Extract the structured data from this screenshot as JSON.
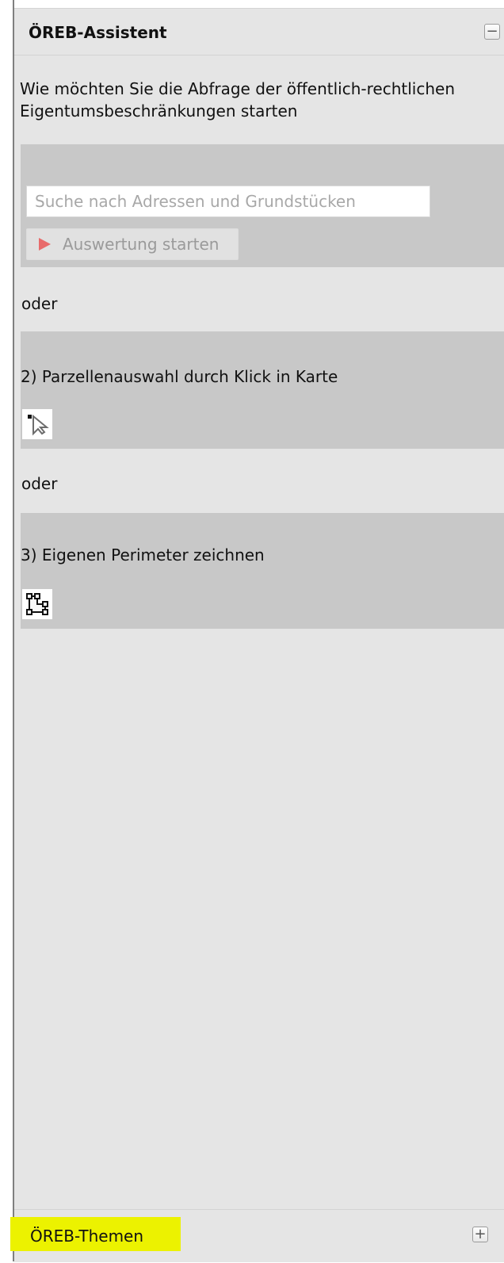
{
  "assistant_panel": {
    "title": "ÖREB-Assistent",
    "collapse_symbol": "−",
    "intro": "Wie möchten Sie die Abfrage der öffentlich-rechtlichen Eigentumsbeschränkungen starten"
  },
  "search_section": {
    "placeholder": "Suche nach Adressen und Grundstücken",
    "start_button_label": "Auswertung starten"
  },
  "separators": [
    "oder",
    "oder"
  ],
  "parcel_section": {
    "label": "2) Parzellenauswahl durch Klick in Karte",
    "icon": "select-parcel-icon"
  },
  "perimeter_section": {
    "label": "3) Eigenen Perimeter zeichnen",
    "icon": "draw-perimeter-icon"
  },
  "themes_panel": {
    "title": "ÖREB-Themen",
    "expand_symbol": "+"
  },
  "colors": {
    "panel_background": "#e5e5e5",
    "section_background": "#c8c8c8",
    "highlight": "#ecf200",
    "start_icon": "#e86b6b"
  }
}
